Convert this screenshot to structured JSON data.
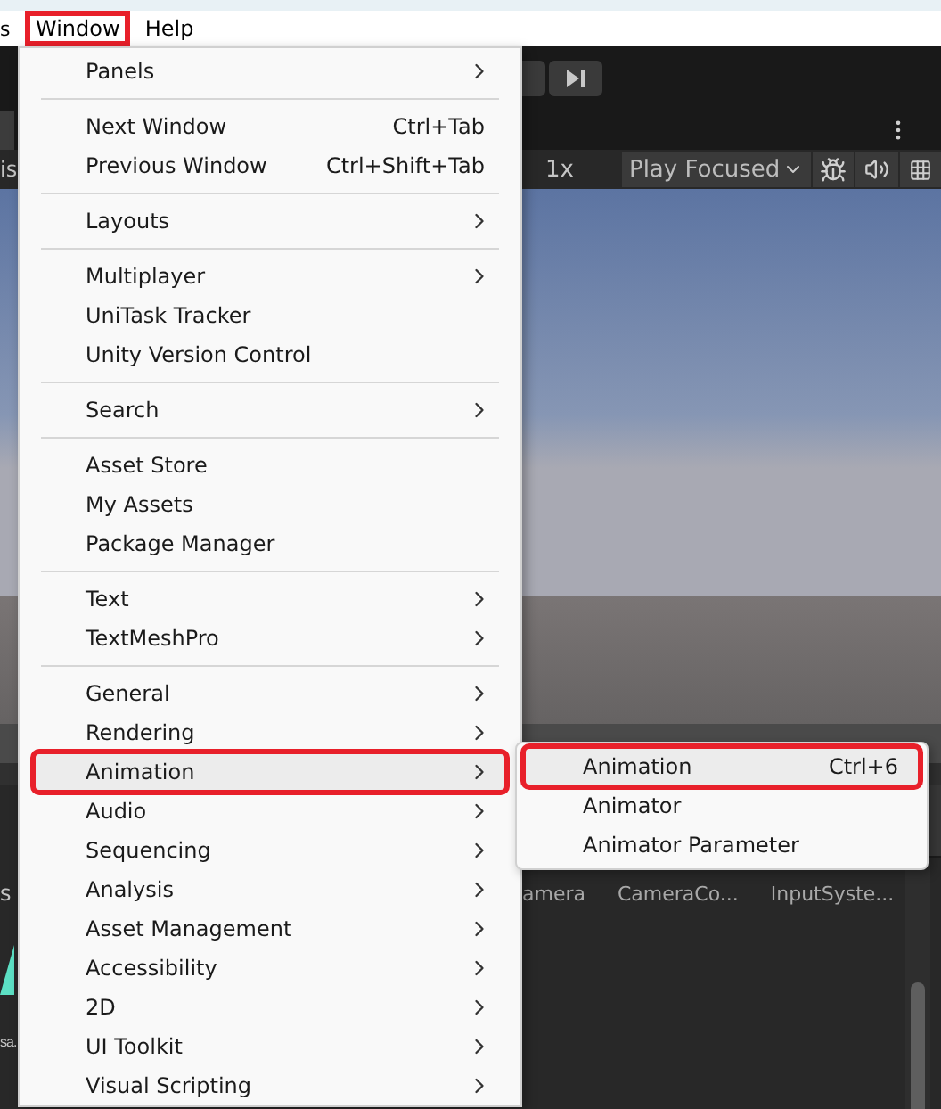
{
  "menubar": [
    {
      "label": "s",
      "annotated": false
    },
    {
      "label": "Window",
      "annotated": true
    },
    {
      "label": "Help",
      "annotated": false
    }
  ],
  "toolbar": {
    "scale": "1x",
    "play_mode": "Play Focused"
  },
  "left_edge": {
    "tab": "is",
    "asset_label": "s",
    "asset_name": "sa."
  },
  "project_panel": {
    "items": [
      "amera",
      "CameraCo...",
      "InputSyste..."
    ]
  },
  "menu": {
    "sections": [
      [
        {
          "label": "Panels",
          "submenu": true,
          "selected": false,
          "annotated": false
        }
      ],
      [
        {
          "label": "Next Window",
          "shortcut": "Ctrl+Tab",
          "submenu": false,
          "selected": false,
          "annotated": false
        },
        {
          "label": "Previous Window",
          "shortcut": "Ctrl+Shift+Tab",
          "submenu": false,
          "selected": false,
          "annotated": false
        }
      ],
      [
        {
          "label": "Layouts",
          "submenu": true,
          "selected": false,
          "annotated": false
        }
      ],
      [
        {
          "label": "Multiplayer",
          "submenu": true,
          "selected": false,
          "annotated": false
        },
        {
          "label": "UniTask Tracker",
          "submenu": false,
          "selected": false,
          "annotated": false
        },
        {
          "label": "Unity Version Control",
          "submenu": false,
          "selected": false,
          "annotated": false
        }
      ],
      [
        {
          "label": "Search",
          "submenu": true,
          "selected": false,
          "annotated": false
        }
      ],
      [
        {
          "label": "Asset Store",
          "submenu": false,
          "selected": false,
          "annotated": false
        },
        {
          "label": "My Assets",
          "submenu": false,
          "selected": false,
          "annotated": false
        },
        {
          "label": "Package Manager",
          "submenu": false,
          "selected": false,
          "annotated": false
        }
      ],
      [
        {
          "label": "Text",
          "submenu": true,
          "selected": false,
          "annotated": false
        },
        {
          "label": "TextMeshPro",
          "submenu": true,
          "selected": false,
          "annotated": false
        }
      ],
      [
        {
          "label": "General",
          "submenu": true,
          "selected": false,
          "annotated": false
        },
        {
          "label": "Rendering",
          "submenu": true,
          "selected": false,
          "annotated": false
        },
        {
          "label": "Animation",
          "submenu": true,
          "selected": true,
          "annotated": true
        },
        {
          "label": "Audio",
          "submenu": true,
          "selected": false,
          "annotated": false
        },
        {
          "label": "Sequencing",
          "submenu": true,
          "selected": false,
          "annotated": false
        },
        {
          "label": "Analysis",
          "submenu": true,
          "selected": false,
          "annotated": false
        },
        {
          "label": "Asset Management",
          "submenu": true,
          "selected": false,
          "annotated": false
        },
        {
          "label": "Accessibility",
          "submenu": true,
          "selected": false,
          "annotated": false
        },
        {
          "label": "2D",
          "submenu": true,
          "selected": false,
          "annotated": false
        },
        {
          "label": "UI Toolkit",
          "submenu": true,
          "selected": false,
          "annotated": false
        },
        {
          "label": "Visual Scripting",
          "submenu": true,
          "selected": false,
          "annotated": false
        }
      ]
    ]
  },
  "submenu": {
    "items": [
      {
        "label": "Animation",
        "shortcut": "Ctrl+6",
        "selected": true,
        "annotated": true
      },
      {
        "label": "Animator",
        "selected": false,
        "annotated": false
      },
      {
        "label": "Animator Parameter",
        "selected": false,
        "annotated": false
      }
    ]
  }
}
